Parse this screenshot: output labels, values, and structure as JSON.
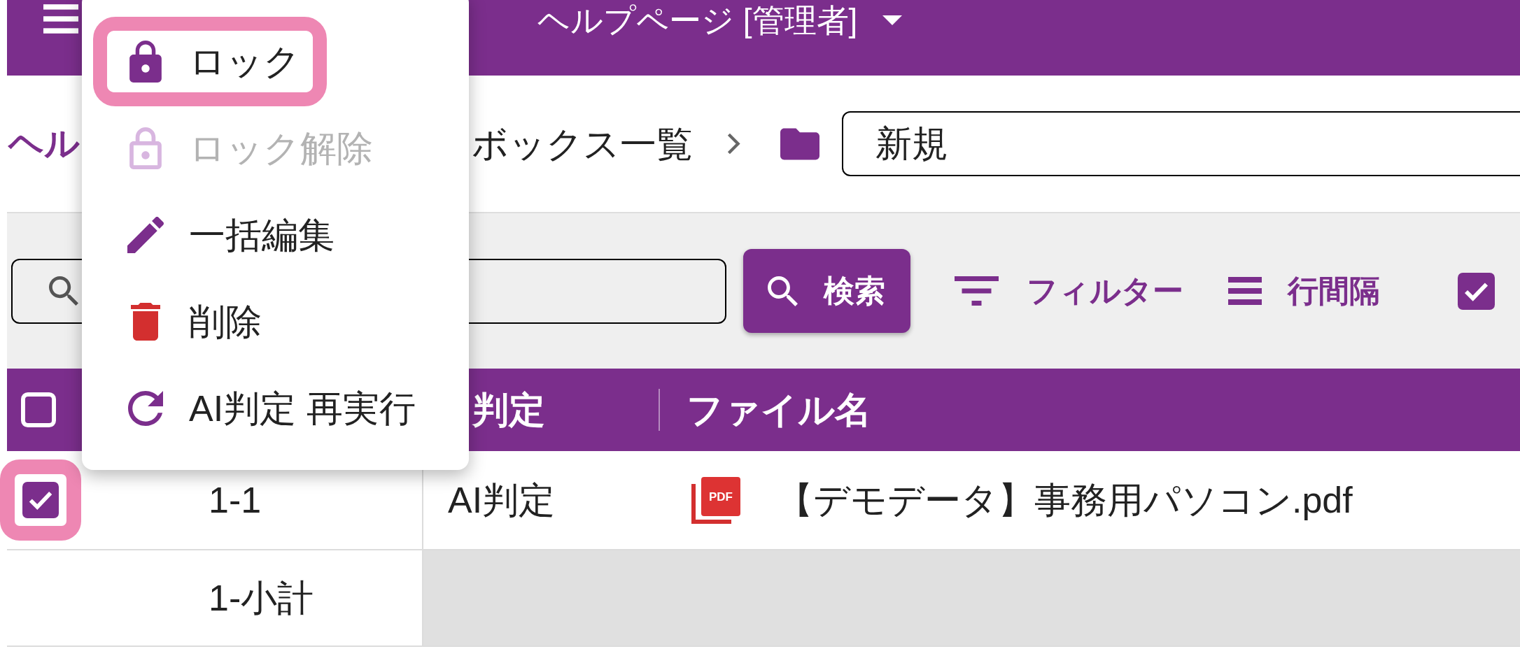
{
  "header": {
    "title": "ヘルプページ [管理者]"
  },
  "breadcrumb": {
    "items": [
      {
        "kind": "link",
        "label": "ヘル"
      },
      {
        "kind": "current",
        "label": "ボックス一覧"
      }
    ],
    "folder_name": "新規"
  },
  "toolbar": {
    "search_button": {
      "label": "検索"
    },
    "filter_button": {
      "label": "フィルター"
    },
    "density_button": {
      "label": "行間隔"
    },
    "checkbox": {
      "checked": true
    }
  },
  "table": {
    "header_checkbox": {
      "checked": false
    },
    "columns": [
      {
        "label": "判定"
      },
      {
        "label": "ファイル名"
      }
    ],
    "rows": [
      {
        "kind": "item",
        "checked": true,
        "highlighted": true,
        "number": "1-1",
        "judgement": "AI判定",
        "file": {
          "icon_text": "PDF",
          "name": "【デモデータ】事務用パソコン.pdf"
        }
      },
      {
        "kind": "subtotal",
        "number": "1-小計"
      }
    ]
  },
  "context_menu": {
    "items": [
      {
        "kind": "lock",
        "label": "ロック",
        "disabled": false,
        "highlighted": true
      },
      {
        "kind": "unlock",
        "label": "ロック解除",
        "disabled": true,
        "highlighted": false
      },
      {
        "kind": "edit",
        "label": "一括編集",
        "disabled": false,
        "highlighted": false
      },
      {
        "kind": "delete",
        "label": "削除",
        "disabled": false,
        "highlighted": false
      },
      {
        "kind": "rerun",
        "label": "AI判定 再実行",
        "disabled": false,
        "highlighted": false
      }
    ]
  }
}
